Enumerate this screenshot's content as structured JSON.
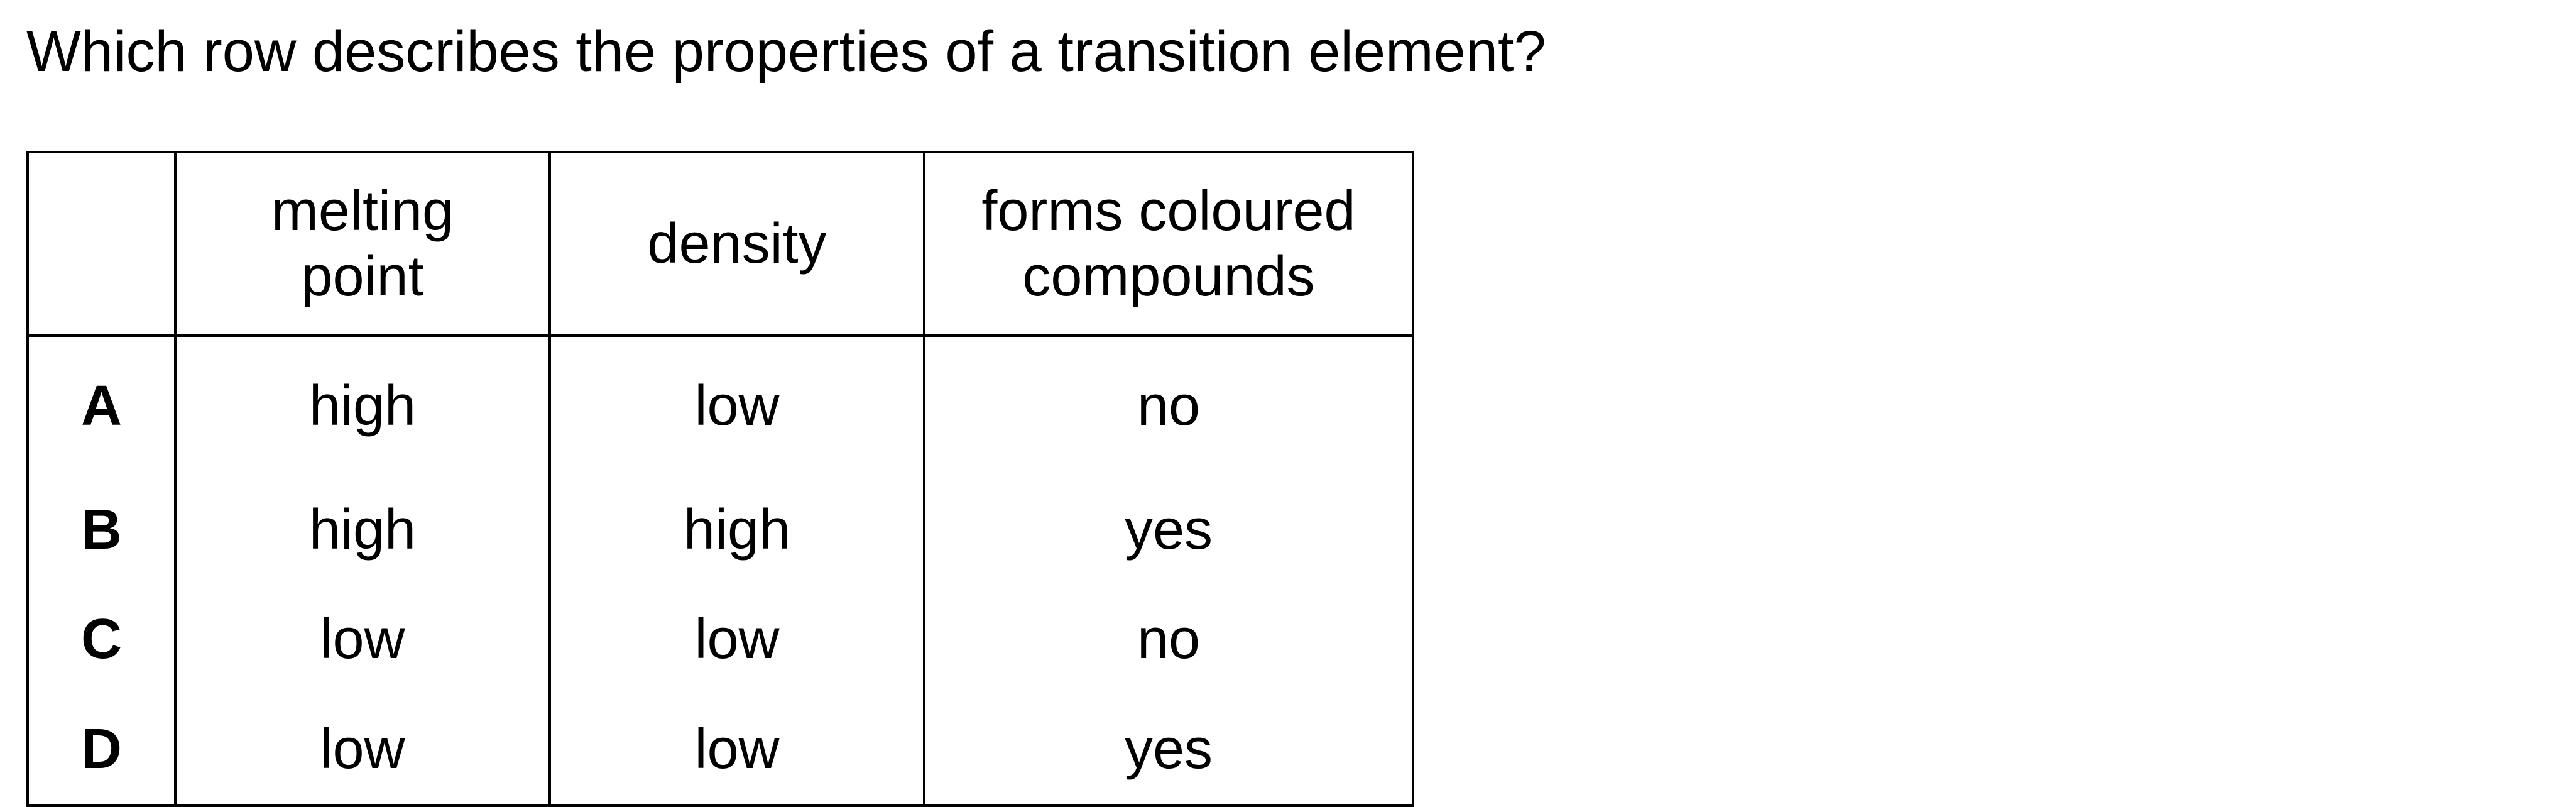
{
  "question": "Which row describes the properties of a transition element?",
  "table": {
    "headers": [
      {
        "lines": [
          ""
        ]
      },
      {
        "lines": [
          "melting",
          "point"
        ]
      },
      {
        "lines": [
          "density"
        ]
      },
      {
        "lines": [
          "forms coloured",
          "compounds"
        ]
      }
    ],
    "rows": [
      {
        "letter": "A",
        "melting_point": "high",
        "density": "low",
        "coloured": "no"
      },
      {
        "letter": "B",
        "melting_point": "high",
        "density": "high",
        "coloured": "yes"
      },
      {
        "letter": "C",
        "melting_point": "low",
        "density": "low",
        "coloured": "no"
      },
      {
        "letter": "D",
        "melting_point": "low",
        "density": "low",
        "coloured": "yes"
      }
    ]
  }
}
